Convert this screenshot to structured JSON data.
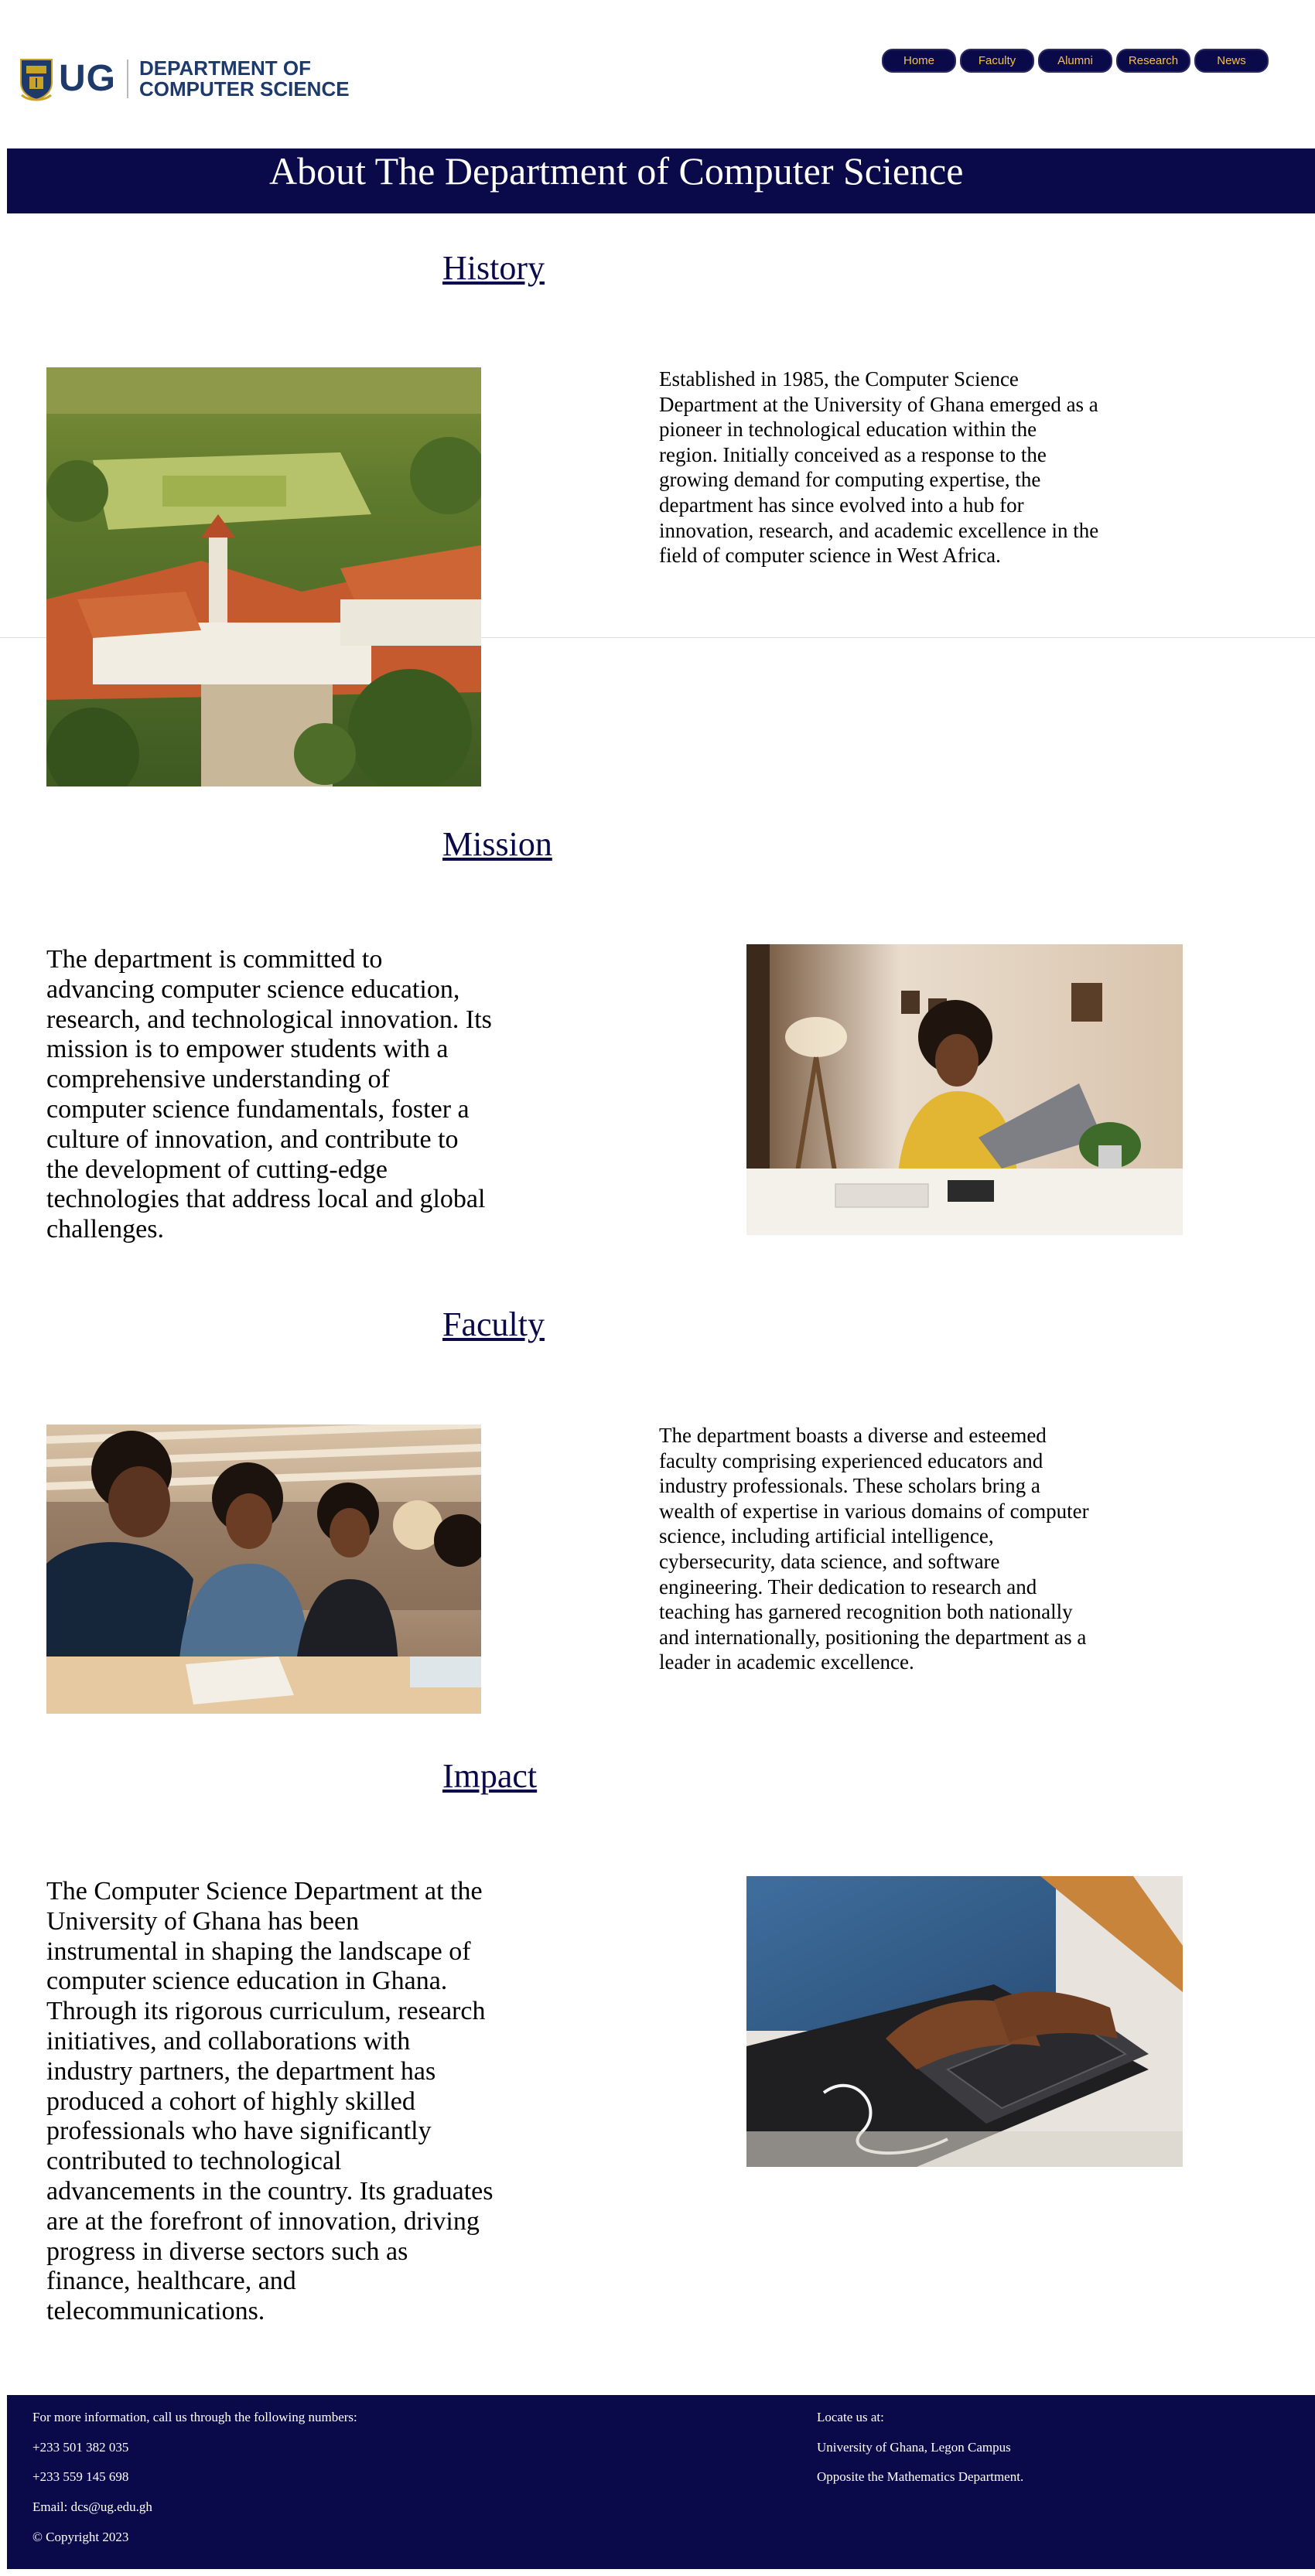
{
  "header": {
    "logo": {
      "short": "UG",
      "dept_line1": "DEPARTMENT OF",
      "dept_line2": "COMPUTER SCIENCE"
    },
    "nav": [
      {
        "label": "Home"
      },
      {
        "label": "Faculty"
      },
      {
        "label": "Alumni"
      },
      {
        "label": "Research"
      },
      {
        "label": "News"
      }
    ]
  },
  "banner": {
    "title": "About The Department of Computer Science"
  },
  "sections": {
    "history": {
      "title": "History",
      "text": "Established in 1985, the Computer Science Department at the University of Ghana emerged as a pioneer in technological education within the region. Initially conceived as a response to the growing demand for computing expertise, the department has since evolved into a hub for innovation, research, and academic excellence in the field of computer science in West Africa.",
      "image": "aerial-campus-photo"
    },
    "mission": {
      "title": "Mission",
      "text": "The department is committed to advancing computer science education, research, and technological innovation. Its mission is to empower students with a comprehensive understanding of computer science fundamentals, foster a culture of innovation, and contribute to the development of cutting-edge technologies that address local and global challenges.",
      "image": "woman-at-laptop-photo"
    },
    "faculty": {
      "title": "Faculty",
      "text": "The department boasts a diverse and esteemed faculty comprising experienced educators and industry professionals. These scholars bring a wealth of expertise in various domains of computer science, including artificial intelligence, cybersecurity, data science, and software engineering. Their dedication to research and teaching has garnered recognition both nationally and internationally, positioning the department as a leader in academic excellence.",
      "image": "students-studying-photo"
    },
    "impact": {
      "title": "Impact",
      "text": "The Computer Science Department at the University of Ghana has been instrumental in shaping the landscape of computer science education in Ghana. Through its rigorous curriculum, research initiatives, and collaborations with industry partners, the department has produced a cohort of highly skilled professionals who have significantly contributed to technological advancements in the country. Its graduates are at the forefront of innovation, driving progress in diverse sectors such as finance, healthcare, and telecommunications.",
      "image": "hands-typing-photo"
    }
  },
  "footer": {
    "info_heading": "For more information, call us through the following numbers:",
    "phone1": "+233 501 382 035",
    "phone2": "+233 559 145 698",
    "email": "Email: dcs@ug.edu.gh",
    "copyright": "© Copyright 2023",
    "locate_heading": "Locate us at:",
    "address1": "University of Ghana, Legon Campus",
    "address2": "Opposite the Mathematics Department."
  },
  "colors": {
    "navy": "#0a0a4a",
    "nav_text": "#f2c14e",
    "logo_blue": "#1d3a6a"
  }
}
